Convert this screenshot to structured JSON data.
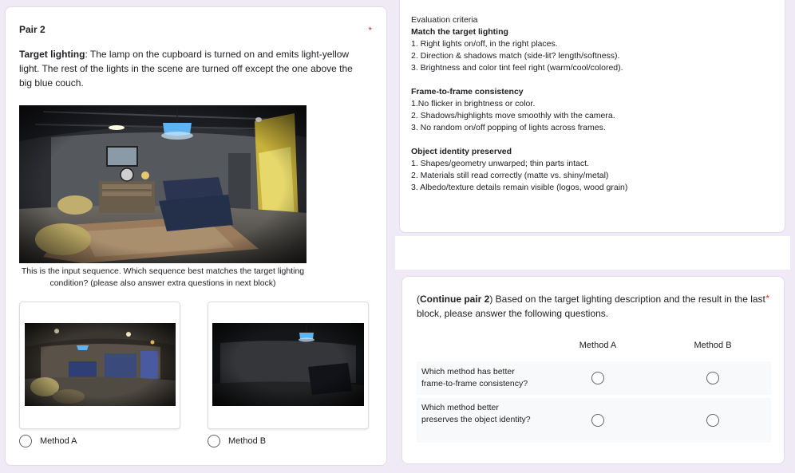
{
  "pair": {
    "title": "Pair 2",
    "required_marker": "*",
    "target_label": "Target lighting",
    "target_text": ": The lamp on the cupboard is turned on and emits light-yellow light. The rest of the lights in the scene are turned off except the one above the big blue couch.",
    "caption": "This is the input sequence. Which sequence best matches the target lighting condition? (please also answer extra questions in next block)",
    "options": [
      {
        "label": "Method A"
      },
      {
        "label": "Method B"
      }
    ]
  },
  "criteria": {
    "heading": "Evaluation criteria",
    "sections": [
      {
        "title": "Match the target lighting",
        "items": [
          "1. Right lights on/off, in the right places.",
          "2. Direction & shadows match (side-lit? length/softness).",
          "3. Brightness and color tint feel right (warm/cool/colored)."
        ]
      },
      {
        "title": "Frame-to-frame consistency",
        "items": [
          "1.No flicker in brightness or color.",
          "2. Shadows/highlights move smoothly with the camera.",
          "3. No random on/off popping of lights across frames."
        ]
      },
      {
        "title": "Object identity preserved",
        "items": [
          "1. Shapes/geometry unwarped; thin parts intact.",
          "2. Materials still read correctly (matte vs. shiny/metal)",
          "3. Albedo/texture details remain visible (logos, wood grain)"
        ]
      }
    ]
  },
  "continue": {
    "prefix": "(",
    "bold": "Continue pair 2",
    "text": ") Based on the target lighting description and the result in the last block, please answer the following questions.",
    "required_marker": "*",
    "columns": [
      "Method A",
      "Method B"
    ],
    "rows": [
      {
        "label": "Which method has better frame-to-frame consistency?"
      },
      {
        "label": "Which method better preserves the object identity?"
      }
    ]
  },
  "colors": {
    "accent_required": "#d93025",
    "page_background": "#efeaf6",
    "lamp_blue": "#5fb3f0"
  }
}
